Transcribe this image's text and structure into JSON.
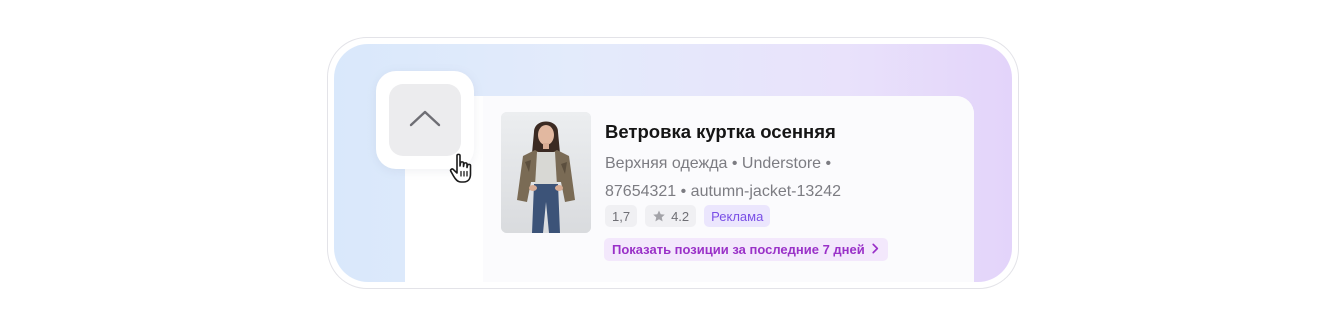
{
  "product": {
    "title": "Ветровка куртка осенняя",
    "meta_line1": "Верхняя одежда • Understore •",
    "meta_line2": "87654321 • autumn-jacket-13242",
    "badges": {
      "position": "1,7",
      "rating": "4.2",
      "ad": "Реклама"
    },
    "positions_link": "Показать позиции за последние 7 дней"
  },
  "icons": {
    "scroll_up": "chevron-up-icon",
    "rating": "star-icon",
    "link": "chevron-right-icon",
    "cursor": "hand-pointer-icon"
  },
  "colors": {
    "accent_purple": "#9a31c8",
    "ad_badge": "#7a4fe6"
  }
}
